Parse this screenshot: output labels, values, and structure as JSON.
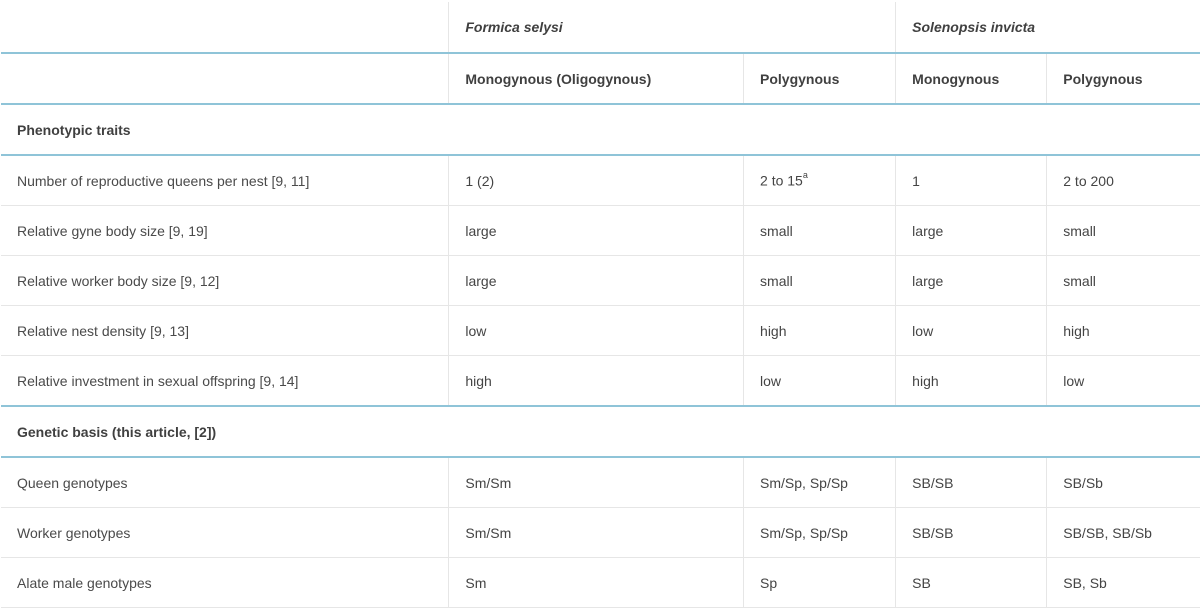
{
  "table": {
    "species": [
      {
        "name": "Formica selysi"
      },
      {
        "name": "Solenopsis invicta"
      }
    ],
    "forms": [
      "Monogynous (Oligogynous)",
      "Polygynous",
      "Monogynous",
      "Polygynous"
    ],
    "sections": [
      {
        "title": "Phenotypic traits",
        "rows": [
          {
            "label": "Number of reproductive queens per nest [9, 11]",
            "cells": [
              "1 (2)",
              "2 to 15",
              "1",
              "2 to 200"
            ],
            "footnote": "a"
          },
          {
            "label": "Relative gyne body size [9, 19]",
            "cells": [
              "large",
              "small",
              "large",
              "small"
            ]
          },
          {
            "label": "Relative worker body size [9, 12]",
            "cells": [
              "large",
              "small",
              "large",
              "small"
            ]
          },
          {
            "label": "Relative nest density [9, 13]",
            "cells": [
              "low",
              "high",
              "low",
              "high"
            ]
          },
          {
            "label": "Relative investment in sexual offspring [9, 14]",
            "cells": [
              "high",
              "low",
              "high",
              "low"
            ]
          }
        ]
      },
      {
        "title": "Genetic basis (this article, [2])",
        "rows": [
          {
            "label": "Queen genotypes",
            "cells": [
              "Sm/Sm",
              "Sm/Sp, Sp/Sp",
              "SB/SB",
              "SB/Sb"
            ]
          },
          {
            "label": "Worker genotypes",
            "cells": [
              "Sm/Sm",
              "Sm/Sp, Sp/Sp",
              "SB/SB",
              "SB/SB, SB/Sb"
            ]
          },
          {
            "label": "Alate male genotypes",
            "cells": [
              "Sm",
              "Sp",
              "SB",
              "SB, Sb"
            ]
          }
        ]
      }
    ]
  }
}
